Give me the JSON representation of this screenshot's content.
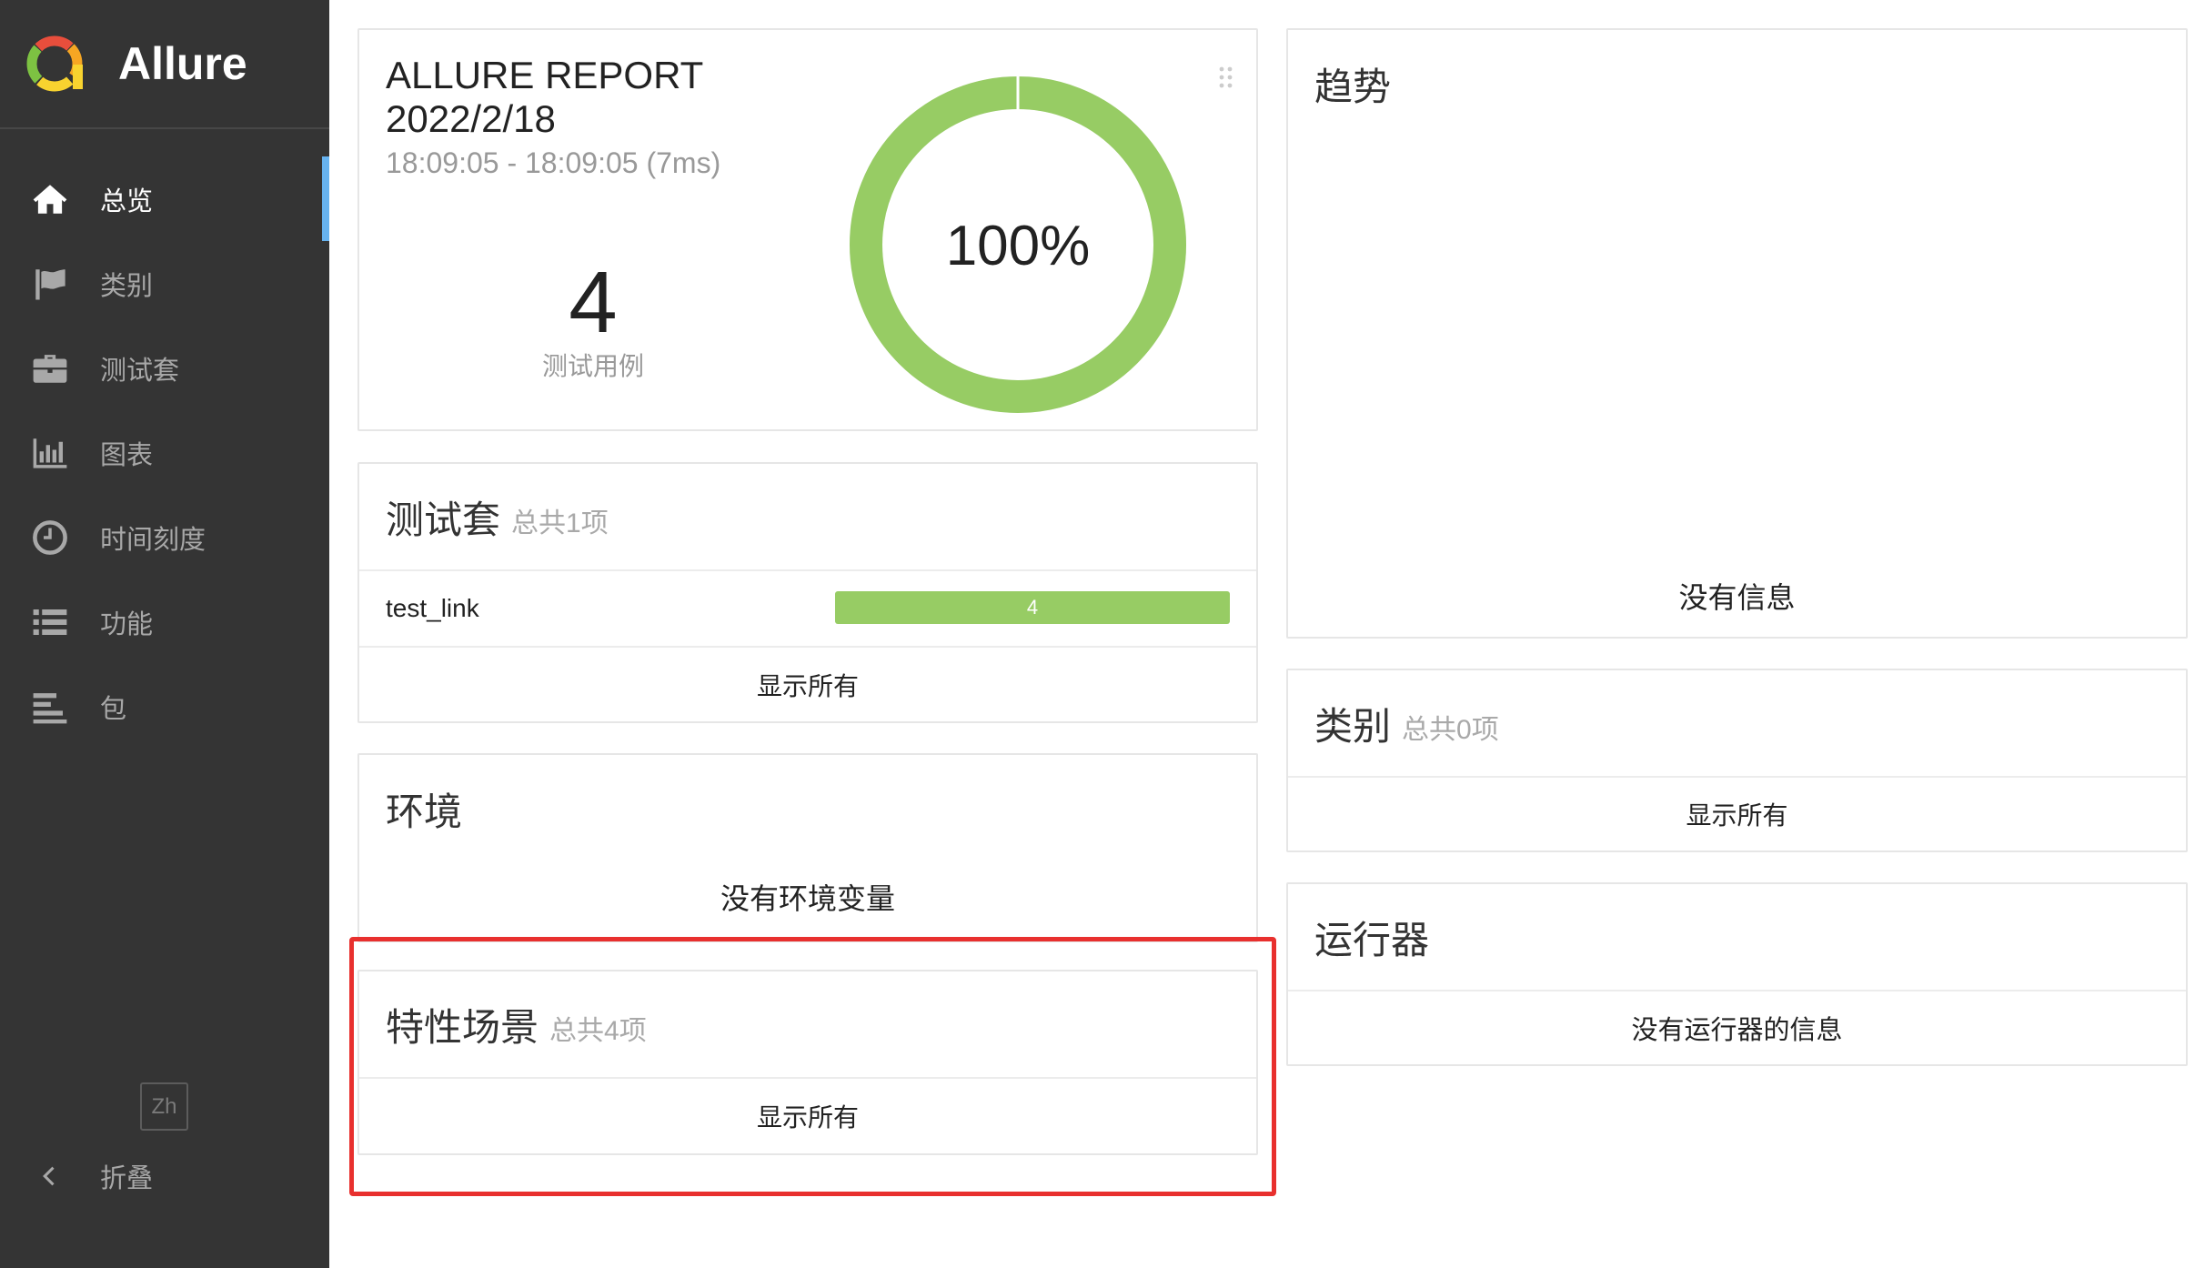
{
  "app": {
    "name": "Allure"
  },
  "sidebar": {
    "items": [
      {
        "label": "总览",
        "icon": "home-icon",
        "active": true
      },
      {
        "label": "类别",
        "icon": "flag-icon",
        "active": false
      },
      {
        "label": "测试套",
        "icon": "briefcase-icon",
        "active": false
      },
      {
        "label": "图表",
        "icon": "bar-chart-icon",
        "active": false
      },
      {
        "label": "时间刻度",
        "icon": "clock-icon",
        "active": false
      },
      {
        "label": "功能",
        "icon": "list-icon",
        "active": false
      },
      {
        "label": "包",
        "icon": "align-left-icon",
        "active": false
      }
    ],
    "lang_label": "Zh",
    "collapse_label": "折叠"
  },
  "summary": {
    "title": "ALLURE REPORT",
    "date": "2022/2/18",
    "time_range": "18:09:05 - 18:09:05 (7ms)",
    "test_count": "4",
    "test_count_label": "测试用例",
    "pass_rate_label": "100%",
    "passed_percent": 100
  },
  "suites": {
    "title": "测试套",
    "count_label": "总共1项",
    "rows": [
      {
        "name": "test_link",
        "count": "4",
        "passed_fraction": 1.0
      }
    ],
    "show_all": "显示所有"
  },
  "environment": {
    "title": "环境",
    "empty": "没有环境变量"
  },
  "features": {
    "title": "特性场景",
    "count_label": "总共4项",
    "show_all": "显示所有"
  },
  "trend": {
    "title": "趋势",
    "empty": "没有信息"
  },
  "categories": {
    "title": "类别",
    "count_label": "总共0项",
    "show_all": "显示所有"
  },
  "executors": {
    "title": "运行器",
    "empty": "没有运行器的信息"
  },
  "colors": {
    "sidebar_bg": "#343434",
    "accent": "#67b3f0",
    "passed": "#97cc64",
    "annotation": "#e8302e"
  }
}
